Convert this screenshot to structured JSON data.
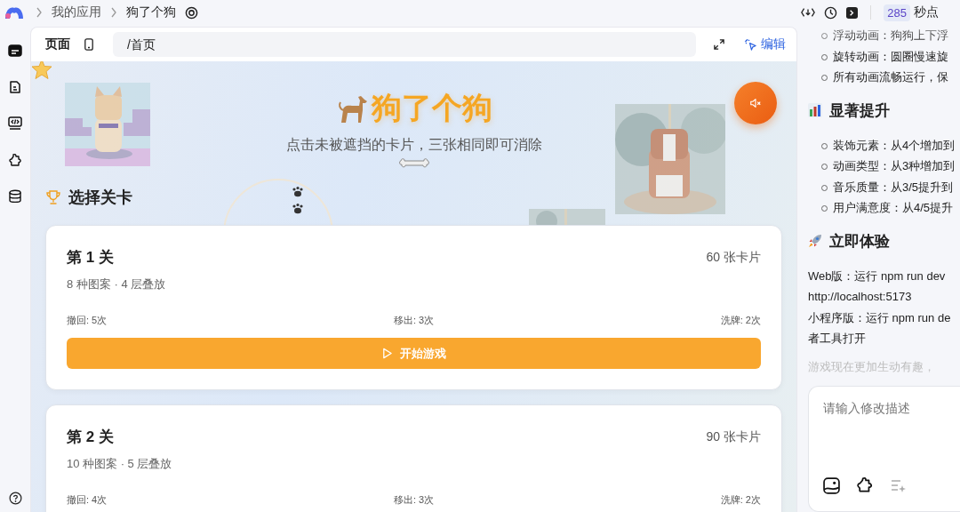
{
  "topbar": {
    "breadcrumbs": [
      "我的应用",
      "狗了个狗"
    ],
    "points": "285",
    "points_label": "秒点"
  },
  "rail_items": [
    {
      "selected": true
    },
    {
      "selected": false
    },
    {
      "selected": false
    },
    {
      "selected": false
    },
    {
      "selected": false
    }
  ],
  "page_header": {
    "tab": "页面",
    "url": "/首页",
    "edit": "编辑"
  },
  "hero": {
    "title": "狗了个狗",
    "subtitle": "点击未被遮挡的卡片，三张相同即可消除",
    "muted": true
  },
  "section_title": "选择关卡",
  "levels": [
    {
      "title": "第 1 关",
      "cards": "60 张卡片",
      "info": "8 种图案 · 4 层叠放",
      "stats": [
        "撤回: 5次",
        "移出: 3次",
        "洗牌: 2次"
      ],
      "button": "开始游戏"
    },
    {
      "title": "第 2 关",
      "cards": "90 张卡片",
      "info": "10 种图案 · 5 层叠放",
      "stats": [
        "撤回: 4次",
        "移出: 3次",
        "洗牌: 2次"
      ]
    }
  ],
  "chat": {
    "bullets_top": [
      "浮动动画：狗狗上下浮",
      "旋转动画：圆圈慢速旋",
      "所有动画流畅运行，保"
    ],
    "heading_1": "显著提升",
    "bullets_mid": [
      "装饰元素：从4个增加到",
      "动画类型：从3种增加到",
      "音乐质量：从3/5提升到",
      "用户满意度：从4/5提升"
    ],
    "heading_2": "立即体验",
    "lines": [
      "Web版：运行 npm run dev",
      "http://localhost:5173",
      "小程序版：运行 npm run de",
      "者工具打开"
    ],
    "faded": "游戏现在更加生动有趣，"
  },
  "composer": {
    "placeholder": "请输入修改描述"
  }
}
